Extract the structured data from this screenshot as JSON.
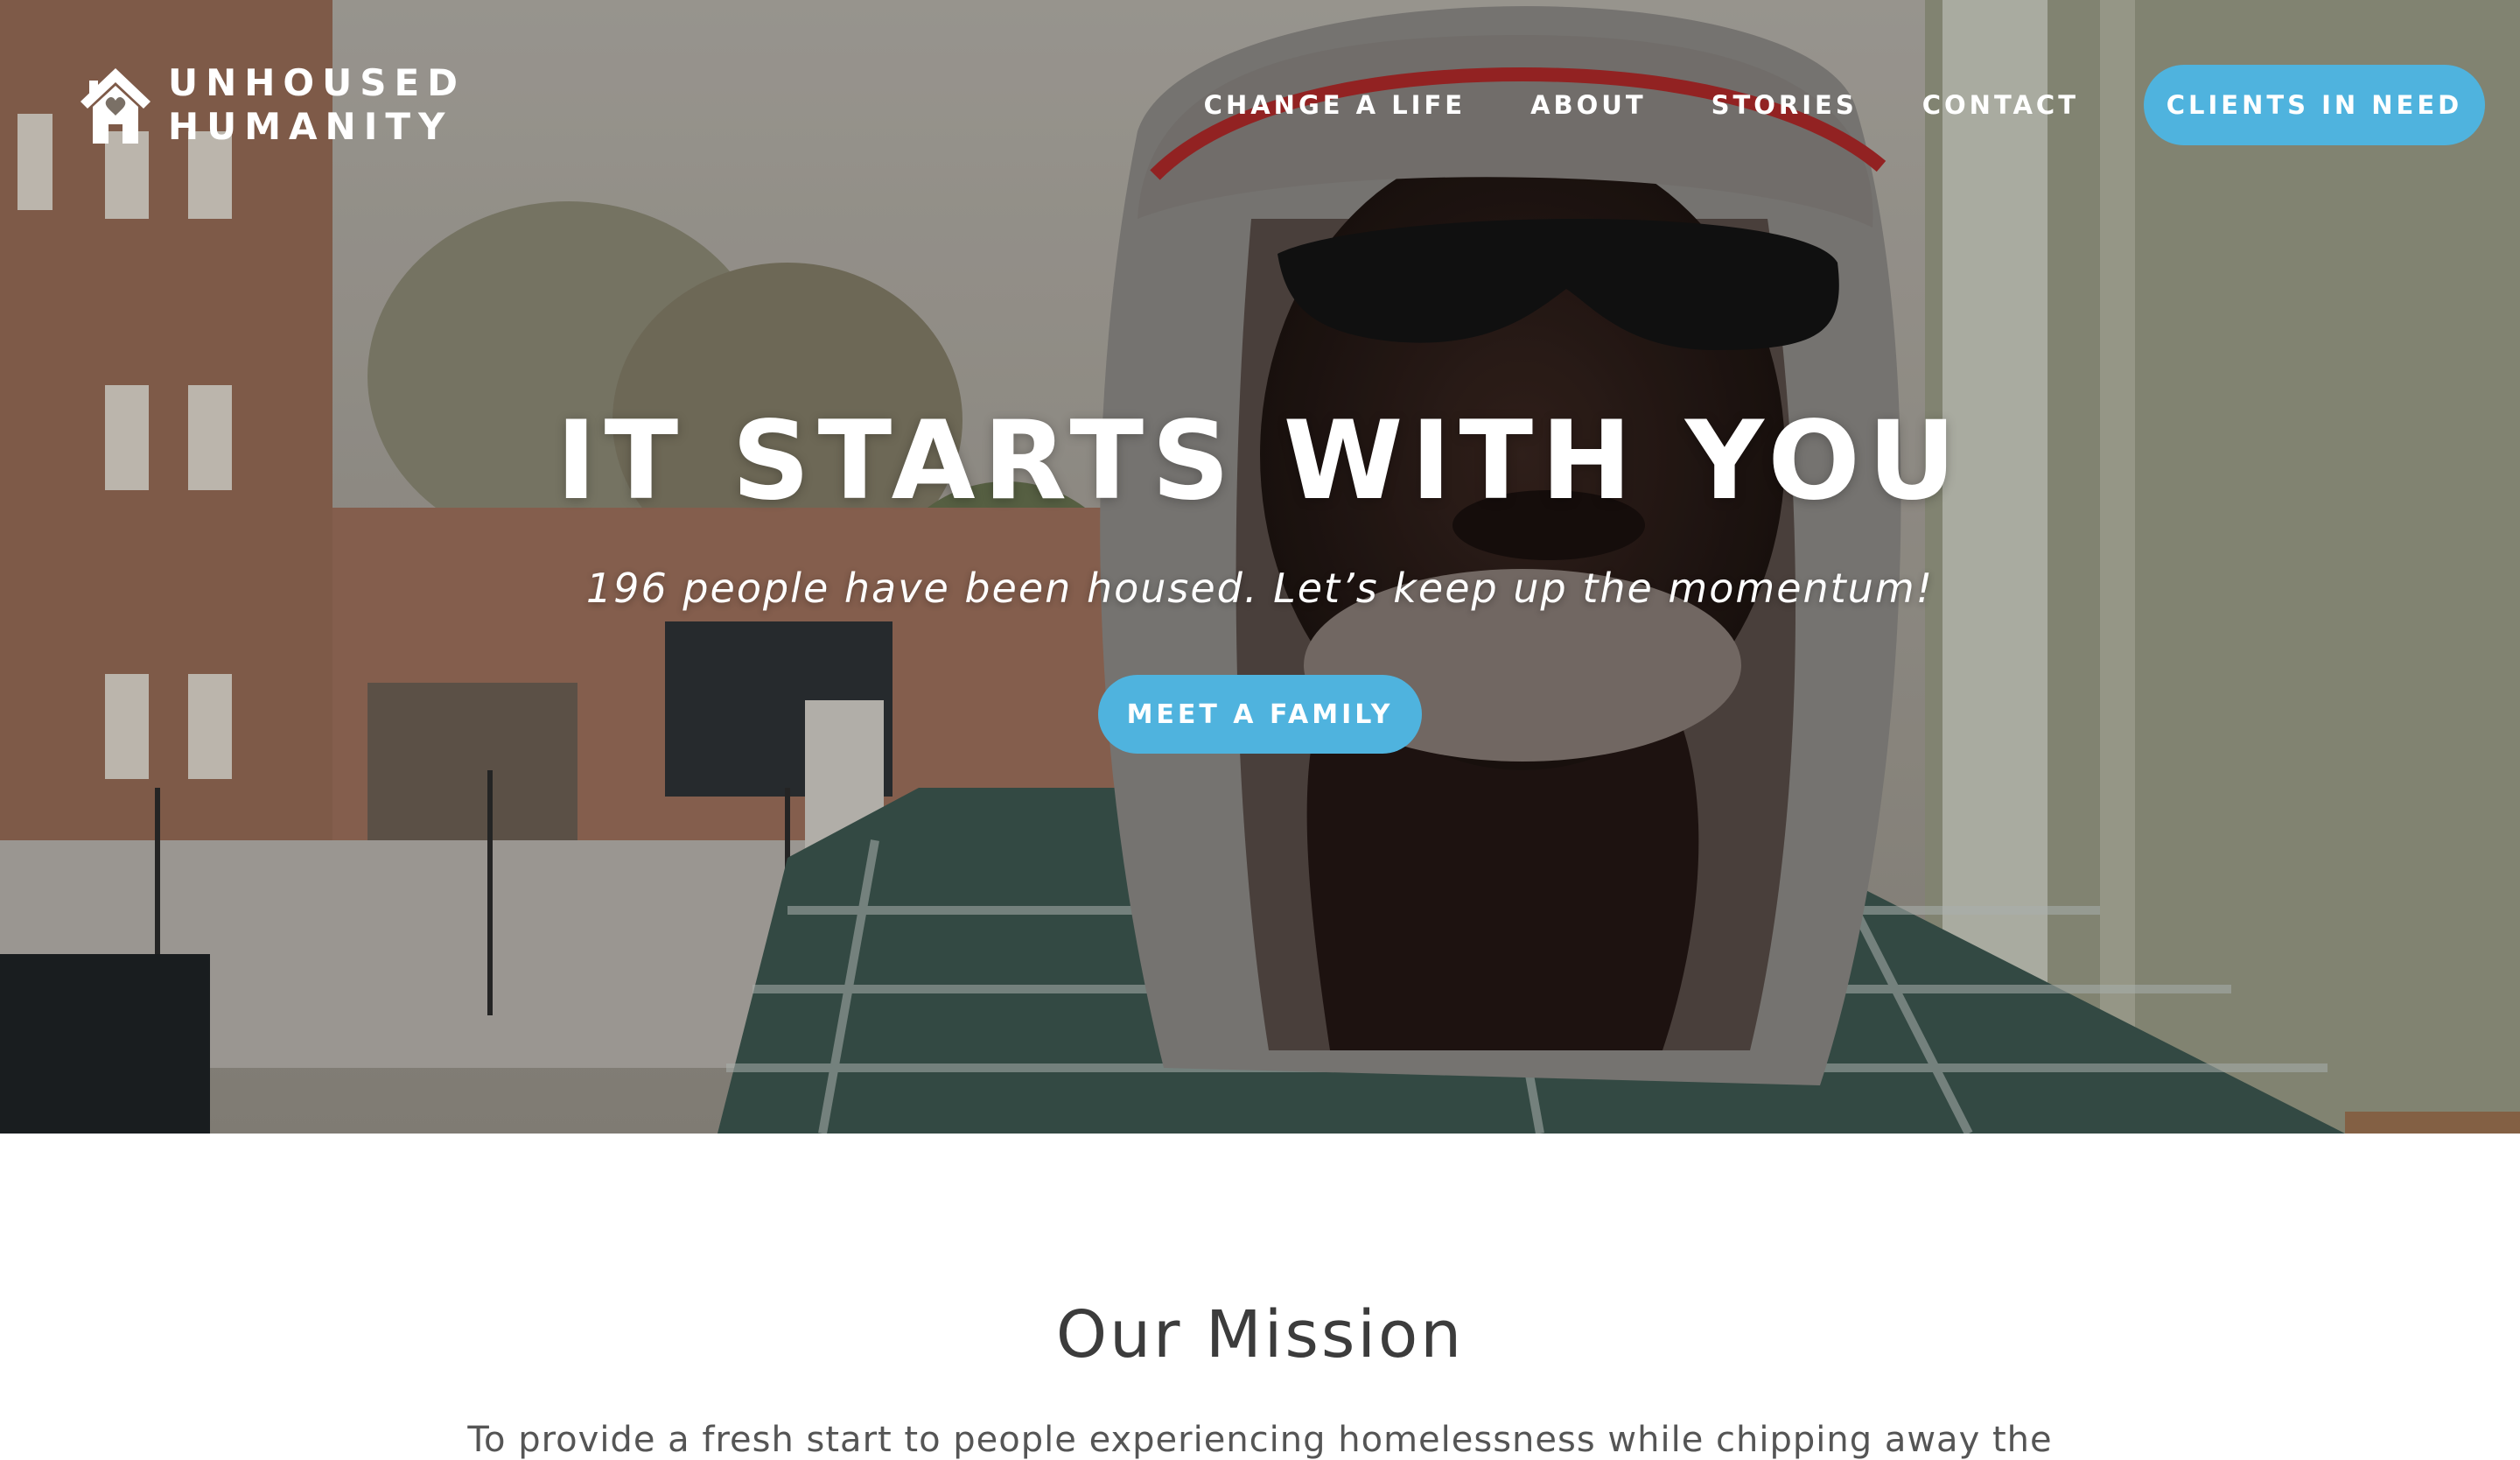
{
  "brand": {
    "line1": "UNHOUSED",
    "line2": "HUMANITY",
    "icon": "house-heart-icon"
  },
  "nav": {
    "items": [
      {
        "label": "CHANGE A LIFE"
      },
      {
        "label": "ABOUT"
      },
      {
        "label": "STORIES"
      },
      {
        "label": "CONTACT"
      }
    ],
    "cta_label": "CLIENTS IN NEED"
  },
  "hero": {
    "title": "IT STARTS WITH YOU",
    "subtitle": "196 people have been housed. Let’s keep up the momentum!",
    "button_label": "MEET A FAMILY"
  },
  "mission": {
    "title": "Our Mission",
    "text": "To provide a fresh start to people experiencing homelessness while chipping away the"
  },
  "colors": {
    "accent": "#4fb3de",
    "heading": "#3c3c3c",
    "body_text": "#555555"
  }
}
